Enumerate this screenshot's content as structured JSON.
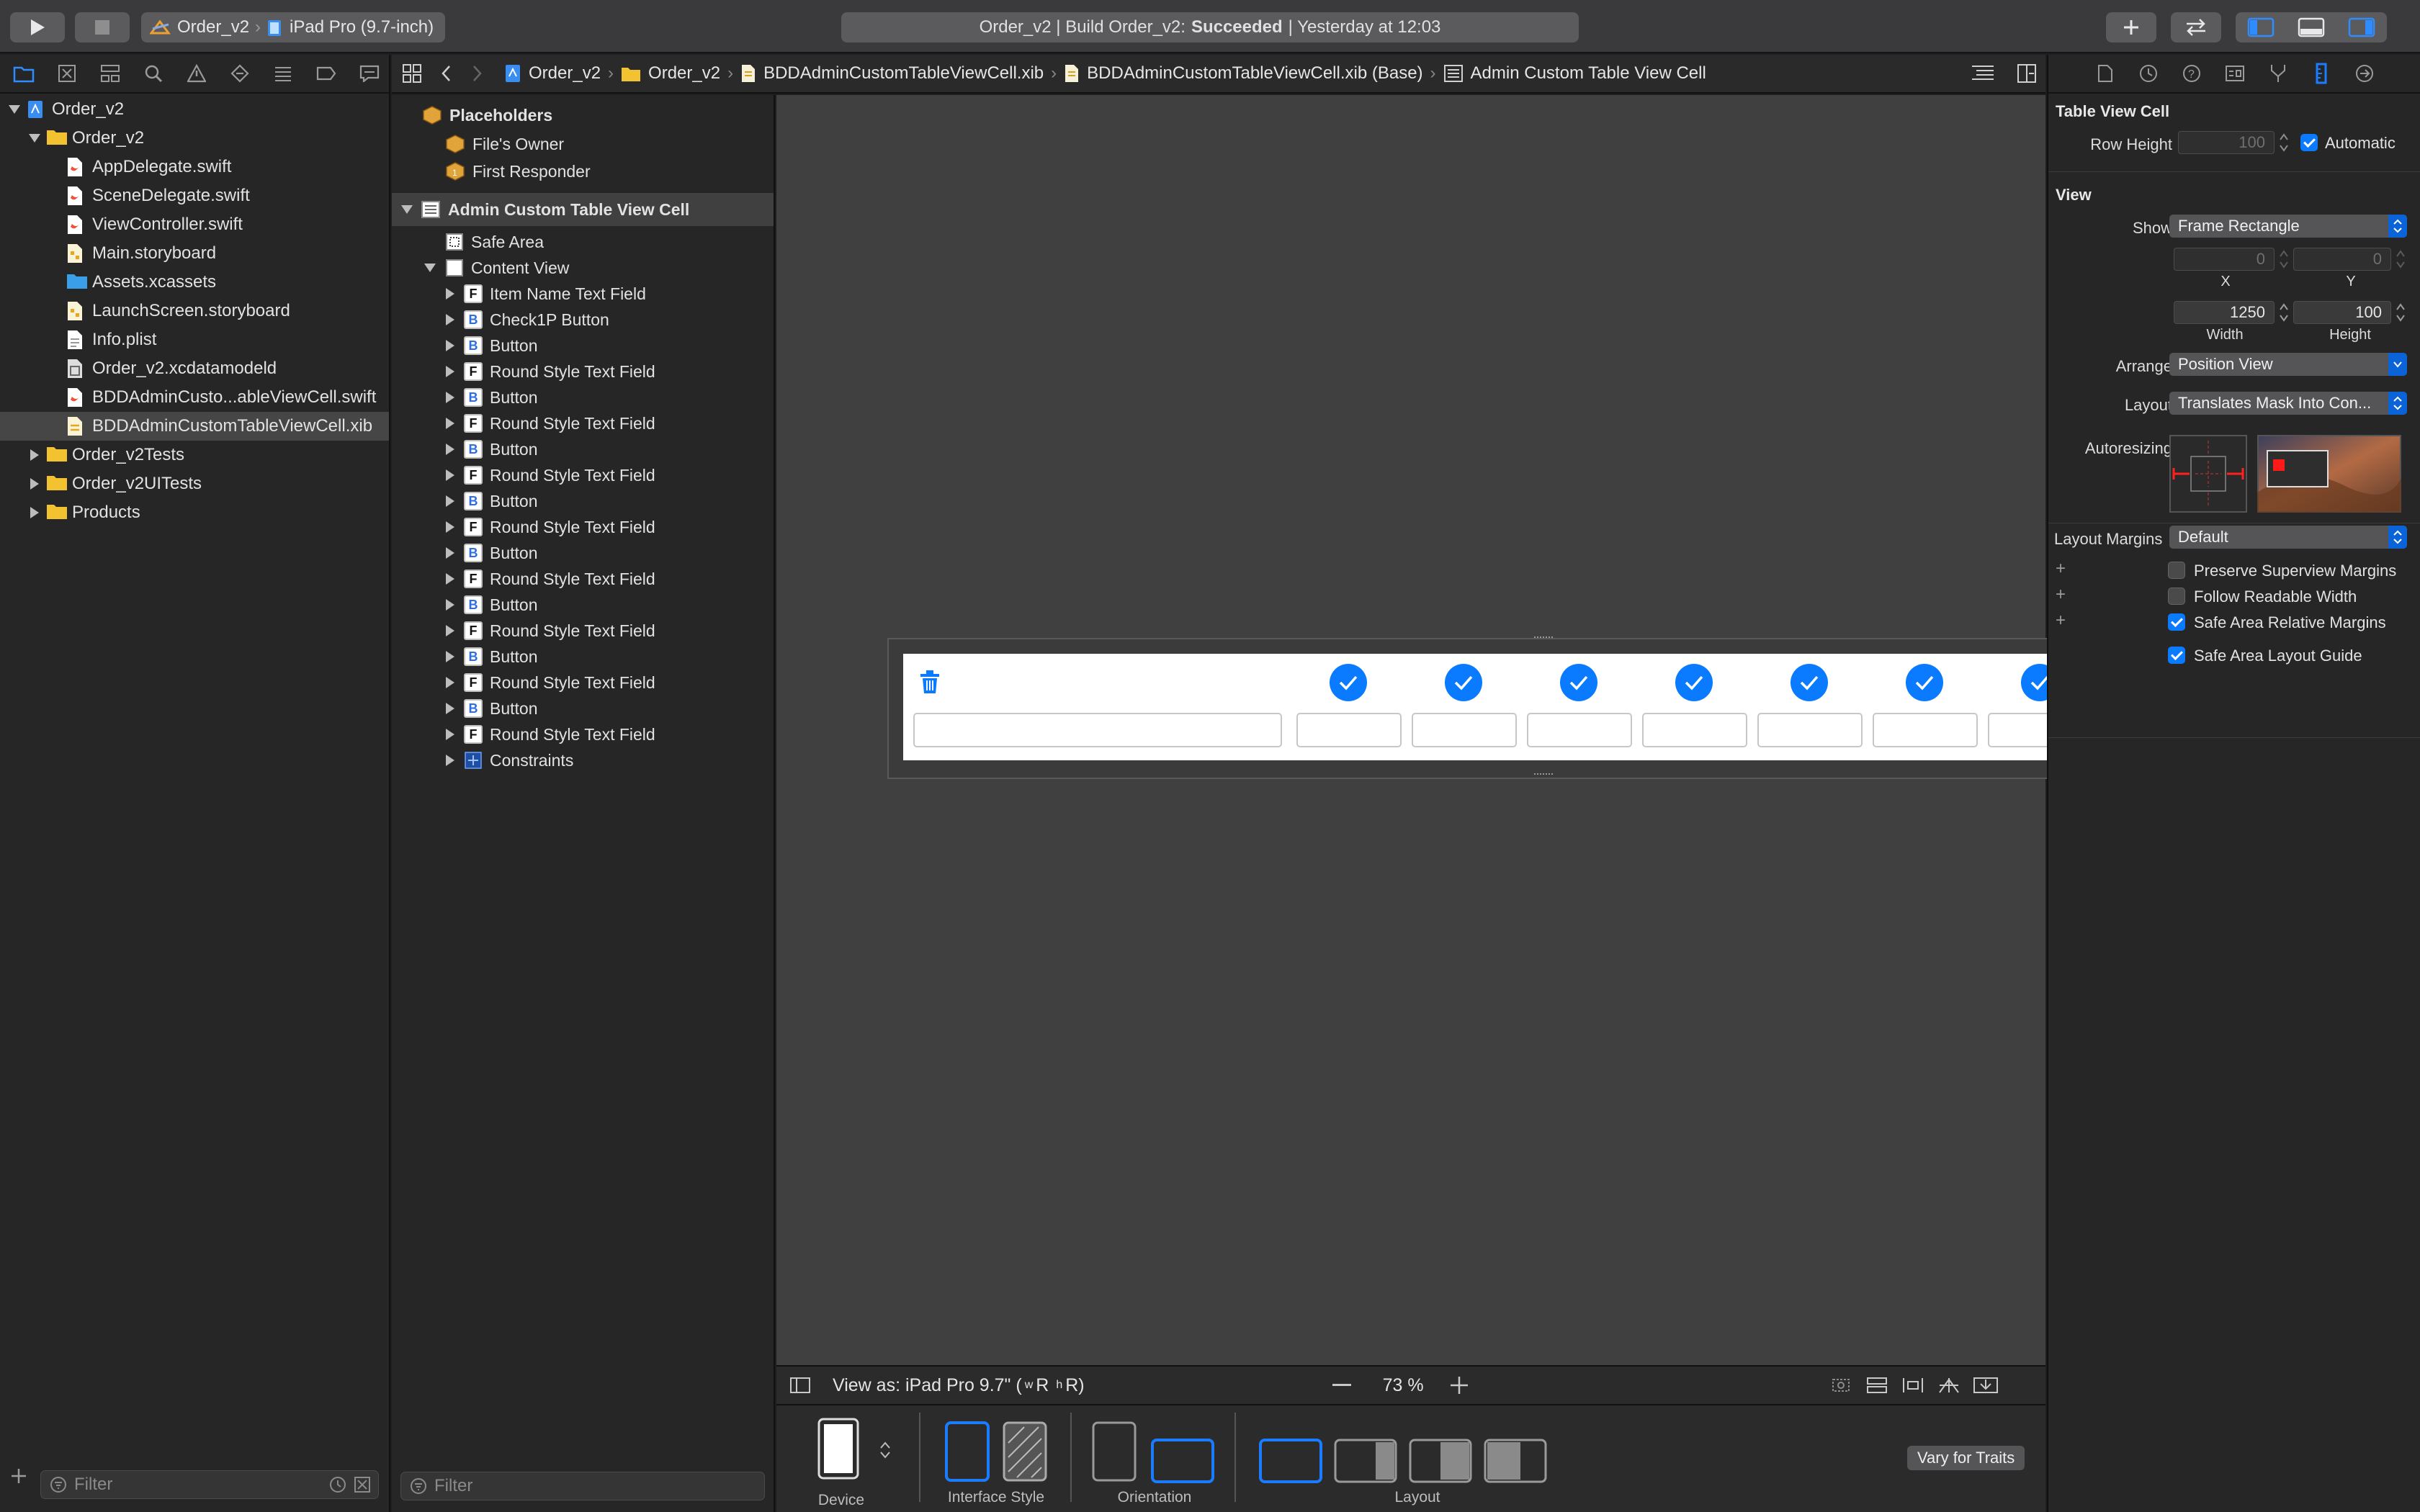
{
  "toolbar": {
    "scheme_name": "Order_v2",
    "device_name": "iPad Pro (9.7-inch)",
    "activity_prefix": "Order_v2 | Build Order_v2:",
    "activity_status": "Succeeded",
    "activity_suffix": "| Yesterday at 12:03"
  },
  "navigator": {
    "items": [
      {
        "label": "Order_v2",
        "kind": "project",
        "level": 0,
        "disclosure": "open"
      },
      {
        "label": "Order_v2",
        "kind": "folder",
        "level": 1,
        "disclosure": "open"
      },
      {
        "label": "AppDelegate.swift",
        "kind": "swift",
        "level": 2
      },
      {
        "label": "SceneDelegate.swift",
        "kind": "swift",
        "level": 2
      },
      {
        "label": "ViewController.swift",
        "kind": "swift",
        "level": 2
      },
      {
        "label": "Main.storyboard",
        "kind": "storyboard",
        "level": 2
      },
      {
        "label": "Assets.xcassets",
        "kind": "assets",
        "level": 2
      },
      {
        "label": "LaunchScreen.storyboard",
        "kind": "storyboard",
        "level": 2
      },
      {
        "label": "Info.plist",
        "kind": "plist",
        "level": 2
      },
      {
        "label": "Order_v2.xcdatamodeld",
        "kind": "datamodel",
        "level": 2
      },
      {
        "label": "BDDAdminCusto...ableViewCell.swift",
        "kind": "swift",
        "level": 2
      },
      {
        "label": "BDDAdminCustomTableViewCell.xib",
        "kind": "xib",
        "level": 2,
        "selected": true
      },
      {
        "label": "Order_v2Tests",
        "kind": "folder",
        "level": 1,
        "disclosure": "closed"
      },
      {
        "label": "Order_v2UITests",
        "kind": "folder",
        "level": 1,
        "disclosure": "closed"
      },
      {
        "label": "Products",
        "kind": "folder",
        "level": 1,
        "disclosure": "closed"
      }
    ],
    "filter_placeholder": "Filter"
  },
  "jumpbar": {
    "crumbs": [
      "Order_v2",
      "Order_v2",
      "BDDAdminCustomTableViewCell.xib",
      "BDDAdminCustomTableViewCell.xib (Base)",
      "Admin Custom Table View Cell"
    ]
  },
  "outline": {
    "placeholders_title": "Placeholders",
    "files_owner": "File's Owner",
    "first_responder": "First Responder",
    "cell_title": "Admin Custom Table View Cell",
    "safe_area": "Safe Area",
    "content_view": "Content View",
    "children": [
      {
        "badge": "F",
        "label": "Item Name Text Field"
      },
      {
        "badge": "B",
        "label": "Check1P Button"
      },
      {
        "badge": "B",
        "label": "Button"
      },
      {
        "badge": "F",
        "label": "Round Style Text Field"
      },
      {
        "badge": "B",
        "label": "Button"
      },
      {
        "badge": "F",
        "label": "Round Style Text Field"
      },
      {
        "badge": "B",
        "label": "Button"
      },
      {
        "badge": "F",
        "label": "Round Style Text Field"
      },
      {
        "badge": "B",
        "label": "Button"
      },
      {
        "badge": "F",
        "label": "Round Style Text Field"
      },
      {
        "badge": "B",
        "label": "Button"
      },
      {
        "badge": "F",
        "label": "Round Style Text Field"
      },
      {
        "badge": "B",
        "label": "Button"
      },
      {
        "badge": "F",
        "label": "Round Style Text Field"
      },
      {
        "badge": "B",
        "label": "Button"
      },
      {
        "badge": "F",
        "label": "Round Style Text Field"
      },
      {
        "badge": "B",
        "label": "Button"
      },
      {
        "badge": "F",
        "label": "Round Style Text Field"
      },
      {
        "badge": "C",
        "label": "Constraints"
      }
    ],
    "filter_placeholder": "Filter"
  },
  "canvas": {
    "view_as_label": "View as: iPad Pro 9.7\" (",
    "size_class_w": "w",
    "size_class_r1": "R",
    "size_class_h": "h",
    "size_class_r2": "R)",
    "zoom": "73 %",
    "device_label": "Device",
    "interface_style_label": "Interface Style",
    "orientation_label": "Orientation",
    "layout_label": "Layout",
    "vary_button": "Vary for Traits"
  },
  "inspector": {
    "table_view_cell_title": "Table View Cell",
    "row_height_label": "Row Height",
    "row_height_value": "100",
    "automatic_label": "Automatic",
    "automatic_checked": true,
    "view_title": "View",
    "show_label": "Show",
    "show_value": "Frame Rectangle",
    "x_value": "0",
    "y_value": "0",
    "x_label": "X",
    "y_label": "Y",
    "width_value": "1250",
    "height_value": "100",
    "width_label": "Width",
    "height_label": "Height",
    "arrange_label": "Arrange",
    "arrange_value": "Position View",
    "layout_label": "Layout",
    "layout_value": "Translates Mask Into Con...",
    "autoresizing_label": "Autoresizing",
    "layout_margins_label": "Layout Margins",
    "layout_margins_value": "Default",
    "checks": [
      {
        "label": "Preserve Superview Margins",
        "checked": false,
        "plus": true
      },
      {
        "label": "Follow Readable Width",
        "checked": false,
        "plus": true
      },
      {
        "label": "Safe Area Relative Margins",
        "checked": true,
        "plus": true
      },
      {
        "label": "Safe Area Layout Guide",
        "checked": true,
        "plus": false
      }
    ]
  },
  "colors": {
    "accent": "#0a7aff",
    "selection": "#464646",
    "canvas": "#404040",
    "autoresize_red": "#ff2020"
  }
}
